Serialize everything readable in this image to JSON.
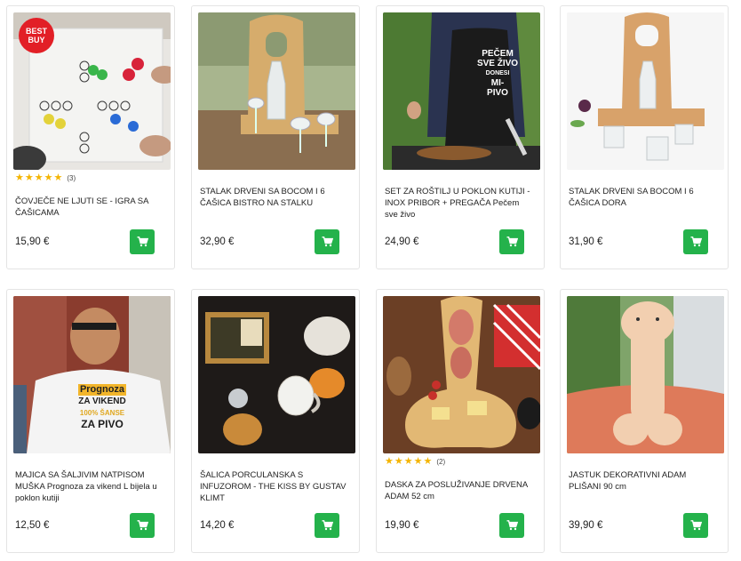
{
  "colors": {
    "cart_button": "#24b24b",
    "badge": "#e21f26",
    "star": "#f4b400"
  },
  "products": [
    {
      "title": "ČOVJEČE NE LJUTI SE - IGRA SA ČAŠICAMA",
      "price": "15,90 €",
      "badge": "BEST BUY",
      "rating": {
        "stars": 5,
        "count": "(3)"
      },
      "cart_icon": "shopping-cart-icon"
    },
    {
      "title": "STALAK DRVENI SA BOCOM I 6 ČAŠICA BISTRO NA STALKU",
      "price": "32,90 €",
      "cart_icon": "shopping-cart-icon"
    },
    {
      "title": "SET ZA ROŠTILJ U POKLON KUTIJI - INOX PRIBOR + PREGAČA Pečem sve živo",
      "price": "24,90 €",
      "apron_text": [
        "PEČEM",
        "SVE ŽIVO",
        "DONESI",
        "MI-",
        "PIVO"
      ],
      "cart_icon": "shopping-cart-icon"
    },
    {
      "title": "STALAK DRVENI SA BOCOM I 6 ČAŠICA DORA",
      "price": "31,90 €",
      "cart_icon": "shopping-cart-icon"
    },
    {
      "title": "MAJICA SA ŠALJIVIM NATPISOM MUŠKA Prognoza za vikend L bijela u poklon kutiji",
      "price": "12,50 €",
      "shirt_text": [
        "Prognoza",
        "ZA VIKEND",
        "100% ŠANSE",
        "ZA PIVO"
      ],
      "cart_icon": "shopping-cart-icon"
    },
    {
      "title": "ŠALICA PORCULANSKA S INFUZOROM - THE KISS BY GUSTAV KLIMT",
      "price": "14,20 €",
      "cart_icon": "shopping-cart-icon"
    },
    {
      "title": "DASKA ZA POSLUŽIVANJE DRVENA ADAM 52 cm",
      "price": "19,90 €",
      "rating": {
        "stars": 5,
        "count": "(2)"
      },
      "cart_icon": "shopping-cart-icon"
    },
    {
      "title": "JASTUK DEKORATIVNI ADAM PLIŠANI 90 cm",
      "price": "39,90 €",
      "cart_icon": "shopping-cart-icon"
    }
  ]
}
